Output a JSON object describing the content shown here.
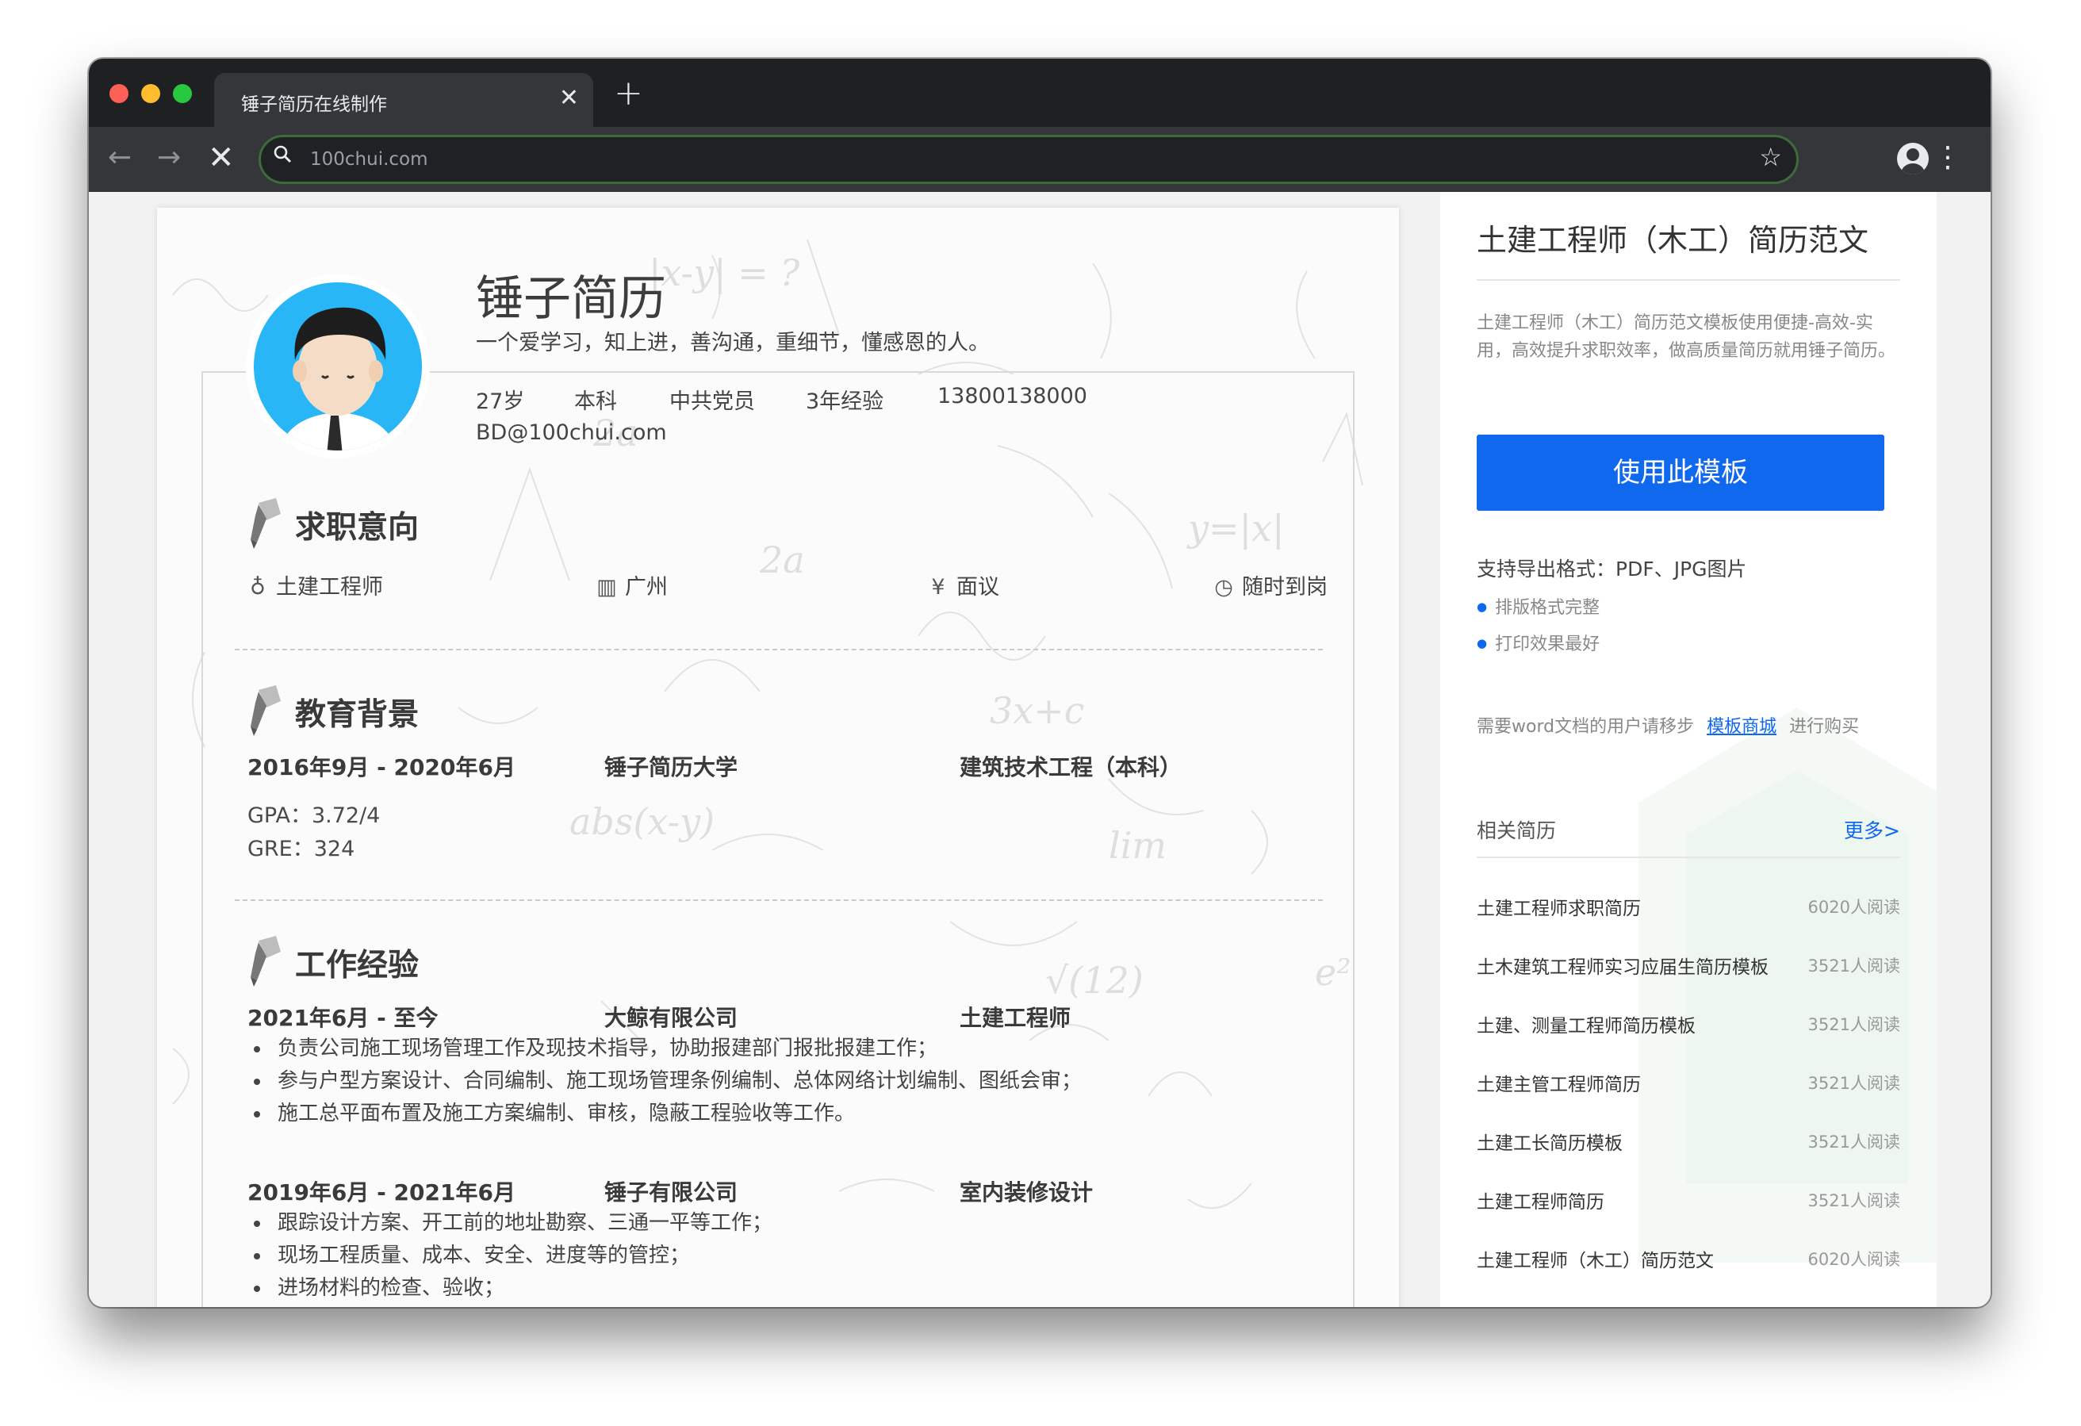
{
  "browser": {
    "tab_title": "锤子简历在线制作",
    "url": "100chui.com"
  },
  "resume": {
    "name": "锤子简历",
    "motto": "一个爱学习，知上进，善沟通，重细节，懂感恩的人。",
    "info": {
      "age": "27岁",
      "degree": "本科",
      "party": "中共党员",
      "experience": "3年经验",
      "phone": "13800138000",
      "email": "BD@100chui.com"
    },
    "intent": {
      "title": "求职意向",
      "position": "土建工程师",
      "city": "广州",
      "salary": "面议",
      "availability": "随时到岗"
    },
    "education": {
      "title": "教育背景",
      "period": "2016年9月 - 2020年6月",
      "school": "锤子简历大学",
      "major": "建筑技术工程（本科）",
      "gpa": "GPA：3.72/4",
      "gre": "GRE：324"
    },
    "work": {
      "title": "工作经验",
      "jobs": [
        {
          "period": "2021年6月 - 至今",
          "company": "大鲸有限公司",
          "role": "土建工程师",
          "duties": [
            "负责公司施工现场管理工作及现技术指导，协助报建部门报批报建工作；",
            "参与户型方案设计、合同编制、施工现场管理条例编制、总体网络计划编制、图纸会审；",
            "施工总平面布置及施工方案编制、审核，隐蔽工程验收等工作。"
          ]
        },
        {
          "period": "2019年6月 - 2021年6月",
          "company": "锤子有限公司",
          "role": "室内装修设计",
          "duties": [
            "跟踪设计方案、开工前的地址勘察、三通一平等工作；",
            "现场工程质量、成本、安全、进度等的管控；",
            "进场材料的检查、验收；"
          ]
        }
      ]
    }
  },
  "sidebar": {
    "title": "土建工程师（木工）简历范文",
    "description": "土建工程师（木工）简历范文模板使用便捷-高效-实用，高效提升求职效率，做高质量简历就用锤子简历。",
    "use_button": "使用此模板",
    "export_formats": "支持导出格式：PDF、JPG图片",
    "features": [
      "排版格式完整",
      "打印效果最好"
    ],
    "buy_prefix": "需要word文档的用户请移步",
    "buy_link": "模板商城",
    "buy_suffix": "进行购买",
    "related_title": "相关简历",
    "related_more": "更多>",
    "related": [
      {
        "name": "土建工程师求职简历",
        "reads": "6020人阅读"
      },
      {
        "name": "土木建筑工程师实习应届生简历模板",
        "reads": "3521人阅读"
      },
      {
        "name": "土建、测量工程师简历模板",
        "reads": "3521人阅读"
      },
      {
        "name": "土建主管工程师简历",
        "reads": "3521人阅读"
      },
      {
        "name": "土建工长简历模板",
        "reads": "3521人阅读"
      },
      {
        "name": "土建工程师简历",
        "reads": "3521人阅读"
      },
      {
        "name": "土建工程师（木工）简历范文",
        "reads": "6020人阅读"
      }
    ]
  },
  "colors": {
    "accent": "#1068ee",
    "avatar_bg": "#29b6f6",
    "chrome": "#35363a"
  },
  "icons": [
    "search-icon",
    "star-icon",
    "profile-icon",
    "menu-icon",
    "back-icon",
    "forward-icon",
    "stop-icon",
    "close-icon",
    "plus-icon",
    "tie-icon",
    "building-icon",
    "yen-icon",
    "clock-icon",
    "pen-icon"
  ]
}
